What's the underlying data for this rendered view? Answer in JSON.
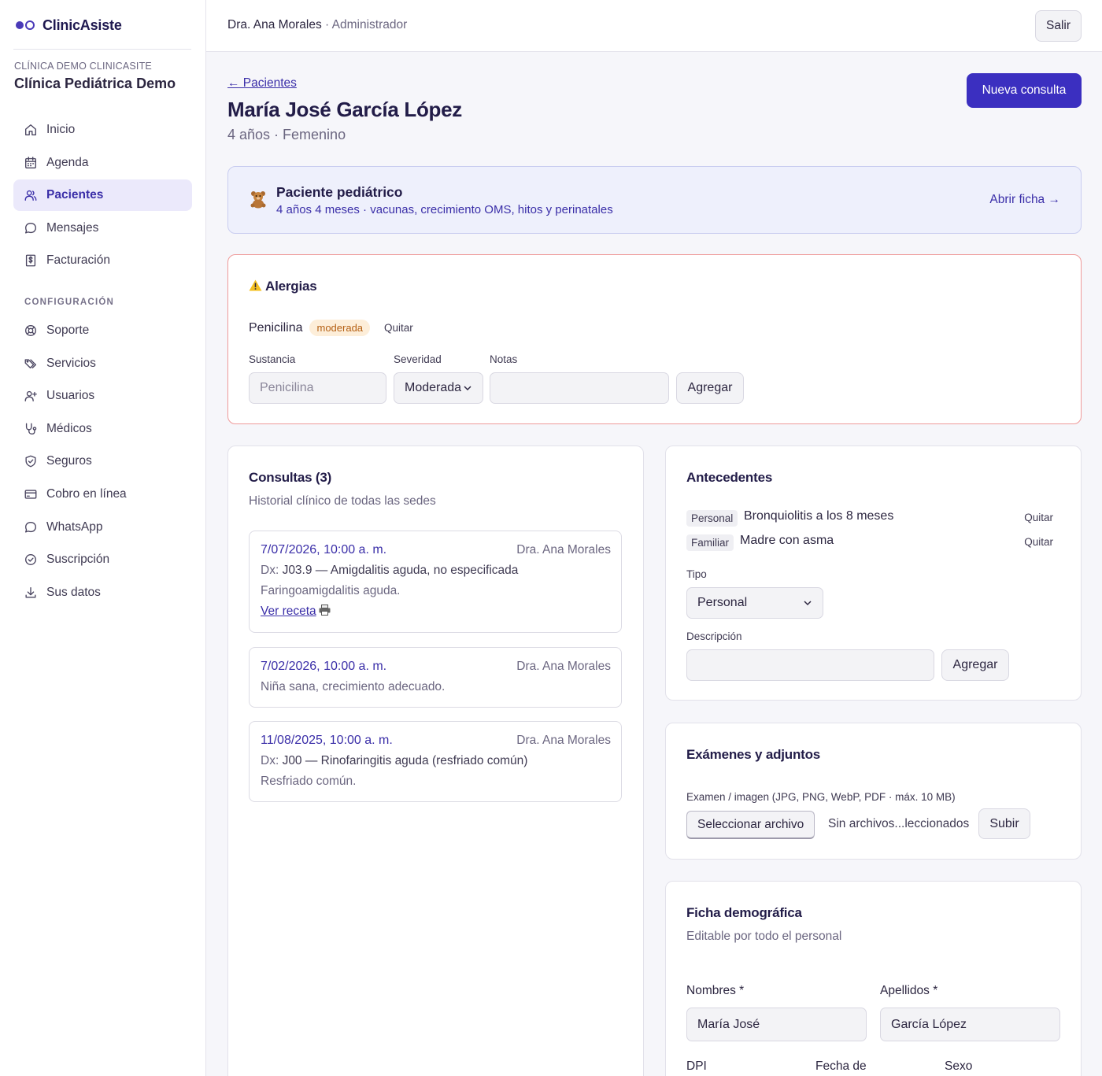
{
  "brand": {
    "name": "ClinicAsiste"
  },
  "clinic": {
    "kicker": "CLÍNICA DEMO CLINICASITE",
    "name": "Clínica Pediátrica Demo"
  },
  "nav_main": [
    {
      "label": "Inicio",
      "icon": "home-icon"
    },
    {
      "label": "Agenda",
      "icon": "calendar-icon"
    },
    {
      "label": "Pacientes",
      "icon": "users-icon",
      "active": true
    },
    {
      "label": "Mensajes",
      "icon": "message-icon"
    },
    {
      "label": "Facturación",
      "icon": "invoice-icon"
    }
  ],
  "nav_section_label": "CONFIGURACIÓN",
  "nav_config": [
    {
      "label": "Soporte",
      "icon": "lifebuoy-icon"
    },
    {
      "label": "Servicios",
      "icon": "tags-icon"
    },
    {
      "label": "Usuarios",
      "icon": "user-plus-icon"
    },
    {
      "label": "Médicos",
      "icon": "stethoscope-icon"
    },
    {
      "label": "Seguros",
      "icon": "shield-icon"
    },
    {
      "label": "Cobro en línea",
      "icon": "credit-card-icon"
    },
    {
      "label": "WhatsApp",
      "icon": "whatsapp-icon"
    },
    {
      "label": "Suscripción",
      "icon": "check-circle-icon"
    },
    {
      "label": "Sus datos",
      "icon": "download-icon"
    }
  ],
  "topbar": {
    "user": "Dra. Ana Morales",
    "separator": " · ",
    "role": "Administrador",
    "logout": "Salir"
  },
  "header": {
    "back": "← Pacientes",
    "patient_name": "María José García López",
    "meta": "4 años · Femenino",
    "new_consult": "Nueva consulta"
  },
  "pediatric": {
    "title": "Paciente pediátrico",
    "subtitle": "4 años 4 meses · vacunas, crecimiento OMS, hitos y perinatales",
    "link": "Abrir ficha →"
  },
  "allergies": {
    "title": "Alergias",
    "items": [
      {
        "name": "Penicilina",
        "severity": "moderada",
        "remove": "Quitar"
      }
    ],
    "form": {
      "substance_label": "Sustancia",
      "substance_placeholder": "Penicilina",
      "severity_label": "Severidad",
      "severity_value": "Moderada",
      "notes_label": "Notas",
      "notes_value": "",
      "add": "Agregar"
    }
  },
  "consultas": {
    "title": "Consultas (3)",
    "subtitle": "Historial clínico de todas las sedes",
    "items": [
      {
        "date": "7/07/2026, 10:00 a. m.",
        "doctor": "Dra. Ana Morales",
        "dx_label": "Dx:",
        "dx": "J03.9 — Amigdalitis aguda, no especificada",
        "note": "Faringoamigdalitis aguda.",
        "link": "Ver receta"
      },
      {
        "date": "7/02/2026, 10:00 a. m.",
        "doctor": "Dra. Ana Morales",
        "note": "Niña sana, crecimiento adecuado."
      },
      {
        "date": "11/08/2025, 10:00 a. m.",
        "doctor": "Dra. Ana Morales",
        "dx_label": "Dx:",
        "dx": "J00 — Rinofaringitis aguda (resfriado común)",
        "note": "Resfriado común."
      }
    ]
  },
  "antecedentes": {
    "title": "Antecedentes",
    "items": [
      {
        "type": "Personal",
        "desc": "Bronquiolitis a los 8 meses",
        "remove": "Quitar"
      },
      {
        "type": "Familiar",
        "desc": "Madre con asma",
        "remove": "Quitar"
      }
    ],
    "form": {
      "type_label": "Tipo",
      "type_value": "Personal",
      "desc_label": "Descripción",
      "desc_value": "",
      "add": "Agregar"
    }
  },
  "examenes": {
    "title": "Exámenes y adjuntos",
    "label": "Examen / imagen (JPG, PNG, WebP, PDF · máx. 10 MB)",
    "choose": "Seleccionar archivo",
    "status": "Sin archivos...leccionados",
    "upload": "Subir"
  },
  "ficha": {
    "title": "Ficha demográfica",
    "subtitle": "Editable por todo el personal",
    "nombres_label": "Nombres *",
    "nombres_value": "María José",
    "apellidos_label": "Apellidos *",
    "apellidos_value": "García López",
    "dpi_label": "DPI",
    "fecha_label": "Fecha de",
    "sexo_label": "Sexo"
  }
}
